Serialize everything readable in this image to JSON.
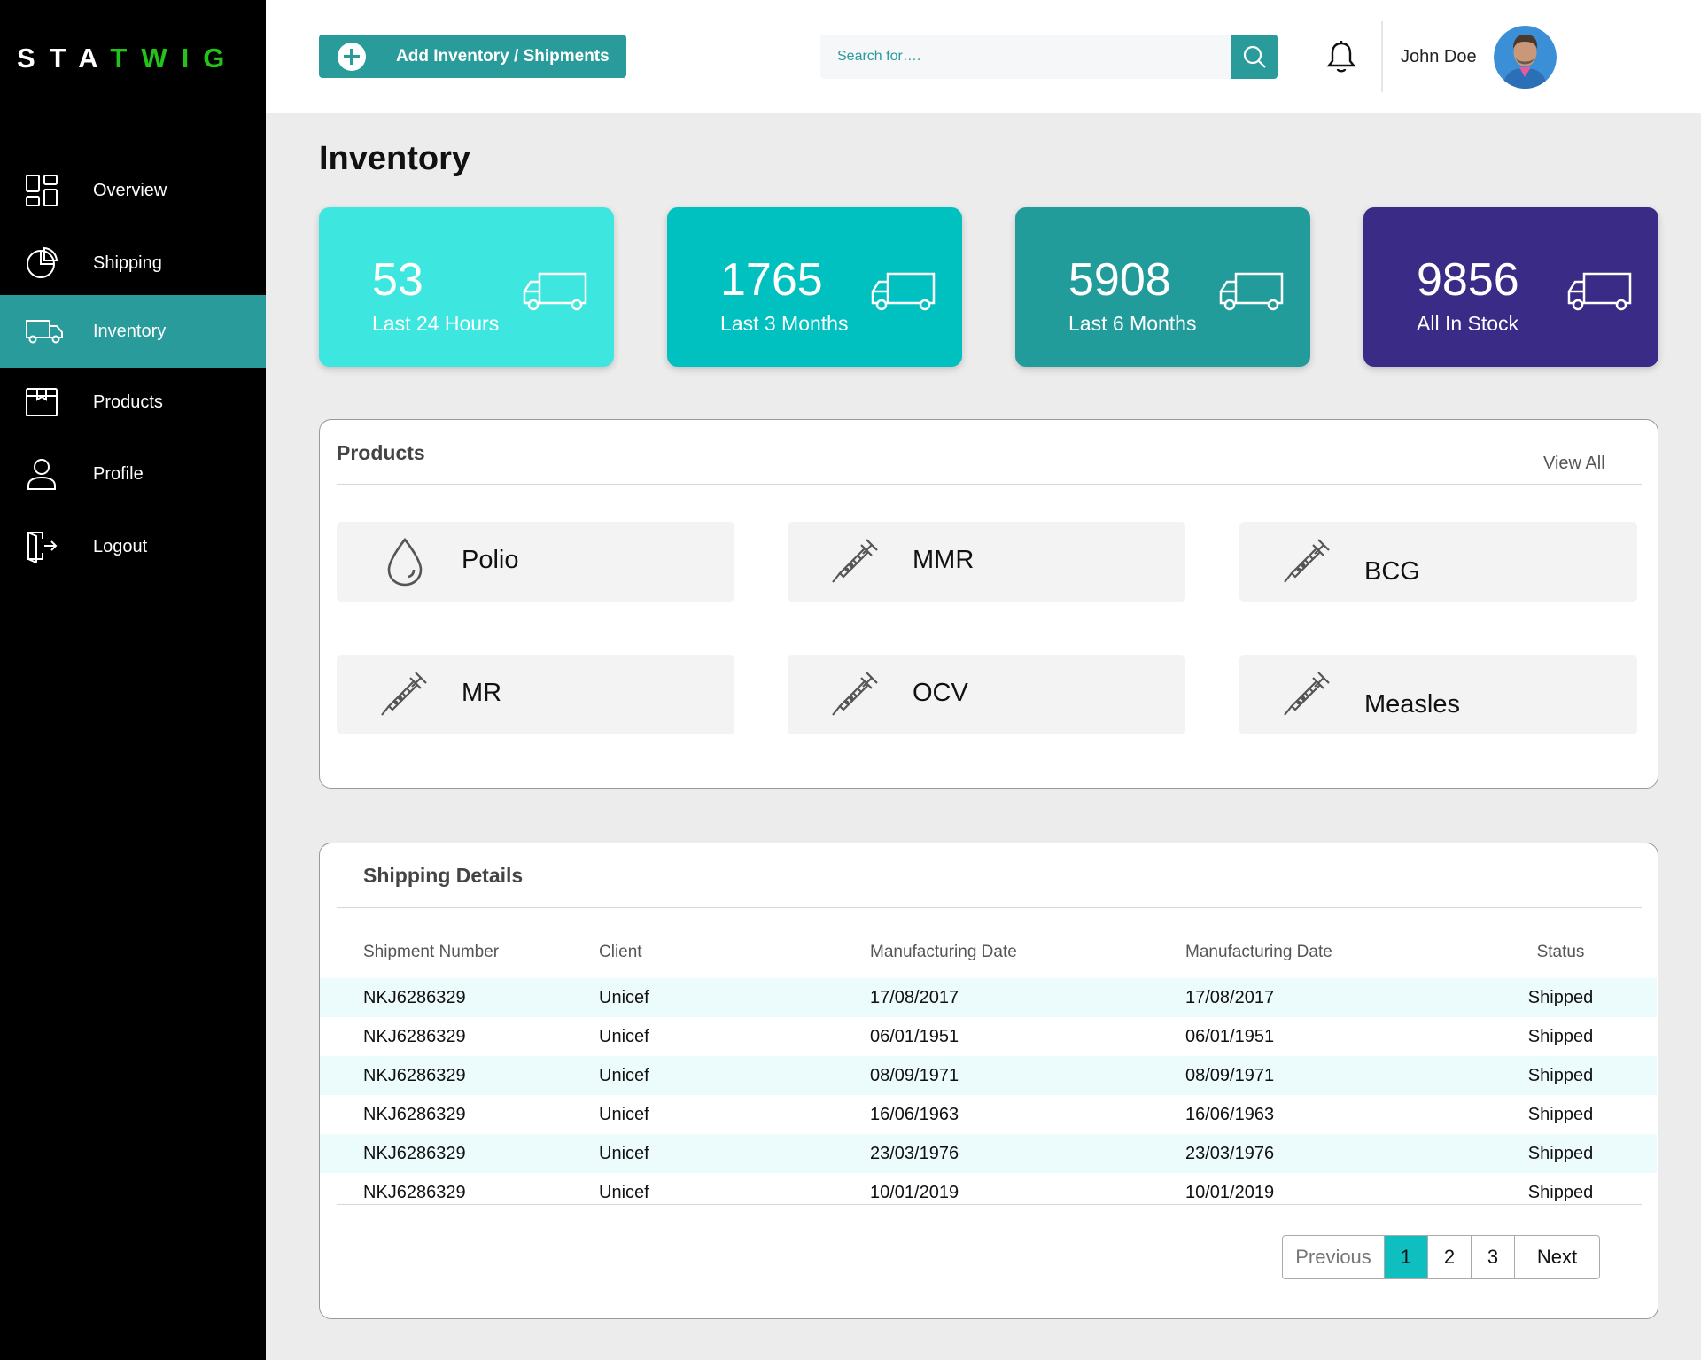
{
  "brand": {
    "logo_white_part": "STA",
    "logo_green_part": "TWIG",
    "green_color": "#22c41a"
  },
  "sidebar": {
    "items": [
      {
        "label": "Overview",
        "icon": "overview-grid-icon"
      },
      {
        "label": "Shipping",
        "icon": "pie-chart-icon"
      },
      {
        "label": "Inventory",
        "icon": "truck-icon",
        "active": true
      },
      {
        "label": "Products",
        "icon": "box-icon"
      },
      {
        "label": "Profile",
        "icon": "user-icon"
      },
      {
        "label": "Logout",
        "icon": "logout-icon"
      }
    ]
  },
  "header": {
    "add_button_label": "Add Inventory / Shipments",
    "search_placeholder": "Search for….",
    "user_name": "John Doe",
    "accent_color": "#2a9b9b"
  },
  "page_title": "Inventory",
  "stat_cards": [
    {
      "value": "53",
      "label": "Last 24 Hours",
      "color": "#3de6de"
    },
    {
      "value": "1765",
      "label": "Last 3 Months",
      "color": "#00c0c0"
    },
    {
      "value": "5908",
      "label": "Last 6 Months",
      "color": "#229b9b"
    },
    {
      "value": "9856",
      "label": "All In Stock",
      "color": "#3a2b86"
    }
  ],
  "products": {
    "title": "Products",
    "view_all": "View All",
    "items": [
      {
        "label": "Polio",
        "icon": "drop-icon"
      },
      {
        "label": "MMR",
        "icon": "syringe-icon"
      },
      {
        "label": "BCG",
        "icon": "syringe-icon"
      },
      {
        "label": "MR",
        "icon": "syringe-icon"
      },
      {
        "label": "OCV",
        "icon": "syringe-icon"
      },
      {
        "label": "Measles",
        "icon": "syringe-icon"
      }
    ]
  },
  "shipping": {
    "title": "Shipping Details",
    "columns": [
      "Shipment Number",
      "Client",
      "Manufacturing Date",
      "Manufacturing Date",
      "Status"
    ],
    "rows": [
      [
        "NKJ6286329",
        "Unicef",
        "17/08/2017",
        "17/08/2017",
        "Shipped"
      ],
      [
        "NKJ6286329",
        "Unicef",
        "06/01/1951",
        "06/01/1951",
        "Shipped"
      ],
      [
        "NKJ6286329",
        "Unicef",
        "08/09/1971",
        "08/09/1971",
        "Shipped"
      ],
      [
        "NKJ6286329",
        "Unicef",
        "16/06/1963",
        "16/06/1963",
        "Shipped"
      ],
      [
        "NKJ6286329",
        "Unicef",
        "23/03/1976",
        "23/03/1976",
        "Shipped"
      ],
      [
        "NKJ6286329",
        "Unicef",
        "10/01/2019",
        "10/01/2019",
        "Shipped"
      ]
    ],
    "pagination": {
      "previous": "Previous",
      "pages": [
        "1",
        "2",
        "3"
      ],
      "current": "1",
      "next": "Next"
    }
  }
}
